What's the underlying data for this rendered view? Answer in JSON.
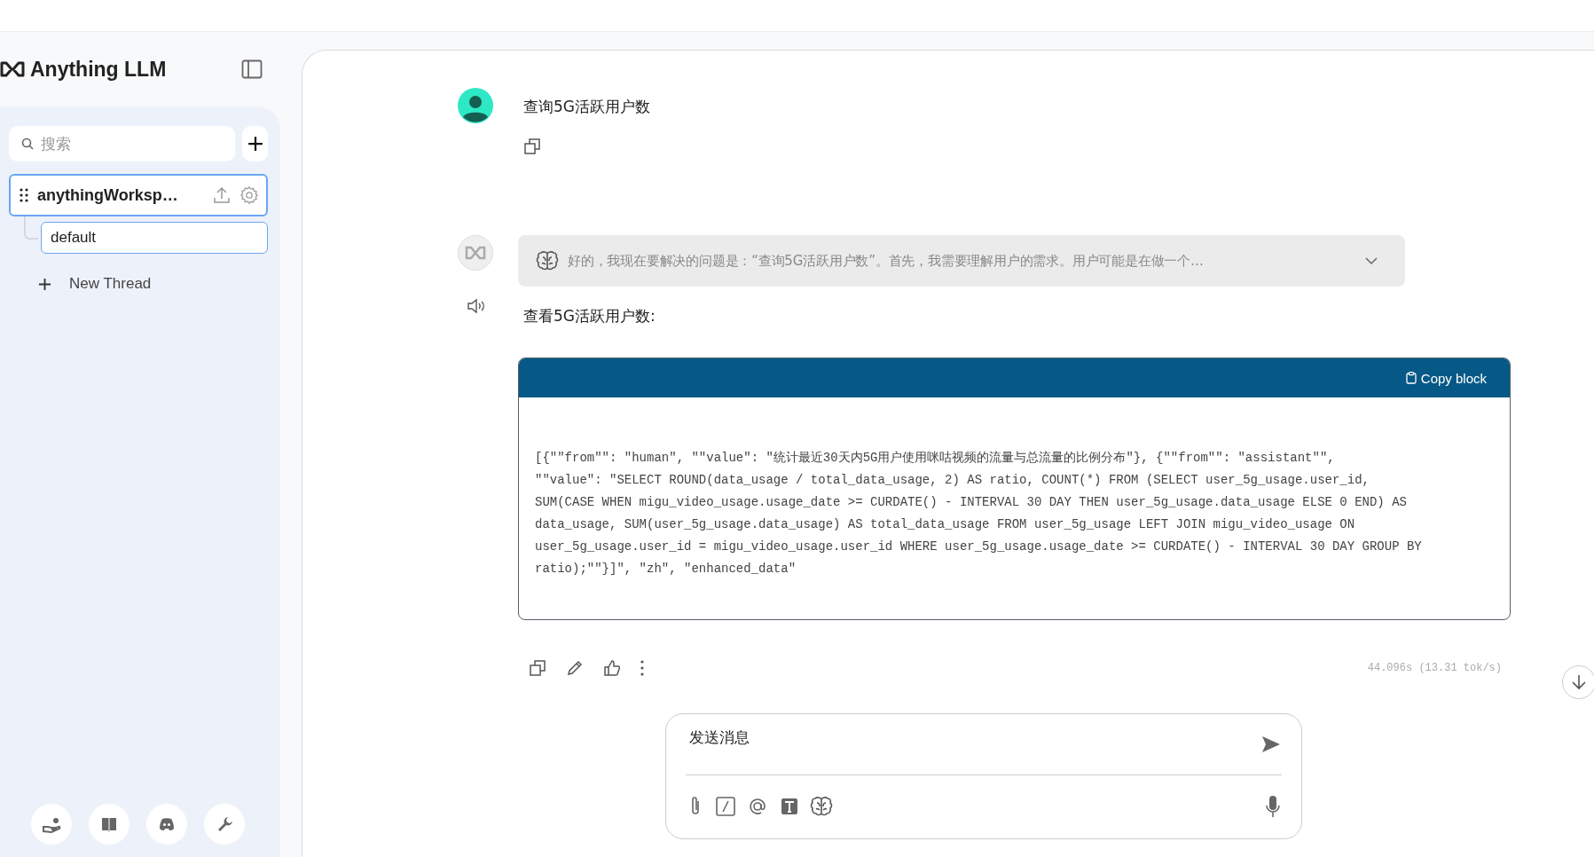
{
  "brand": {
    "name": "Anything LLM"
  },
  "sidebar": {
    "search": {
      "placeholder": "搜索"
    },
    "workspaces": [
      {
        "name": "anythingWorksp…",
        "selected": true,
        "threads": [
          {
            "name": "default",
            "selected": true
          }
        ]
      }
    ],
    "new_thread": "New Thread"
  },
  "chat": {
    "messages": [
      {
        "kind": "user",
        "text": "查询5G活跃用户数"
      },
      {
        "kind": "assistant",
        "thought": {
          "text": "好的，我现在要解决的问题是：“查询5G活跃用户数”。首先，我需要理解用户的需求。用户可能是在做一个…",
          "expanded": false
        },
        "text": "查看5G活跃用户数:",
        "code": {
          "copy_label": "Copy block",
          "text": "[{\"\"from\"\": \"human\", \"\"value\": \"统计最近30天内5G用户使用咪咕视频的流量与总流量的比例分布\"}, {\"\"from\"\": \"assistant\"\",\n\"\"value\": \"SELECT ROUND(data_usage / total_data_usage, 2) AS ratio, COUNT(*) FROM (SELECT user_5g_usage.user_id,\nSUM(CASE WHEN migu_video_usage.usage_date >= CURDATE() - INTERVAL 30 DAY THEN user_5g_usage.data_usage ELSE 0 END) AS\ndata_usage, SUM(user_5g_usage.data_usage) AS total_data_usage FROM user_5g_usage LEFT JOIN migu_video_usage ON\nuser_5g_usage.user_id = migu_video_usage.user_id WHERE user_5g_usage.usage_date >= CURDATE() - INTERVAL 30 DAY GROUP BY\nratio);\"\"}]\", \"zh\", \"enhanced_data\""
        },
        "timing": "44.096s (13.31 tok/s)"
      }
    ]
  },
  "composer": {
    "placeholder": "发送消息"
  }
}
